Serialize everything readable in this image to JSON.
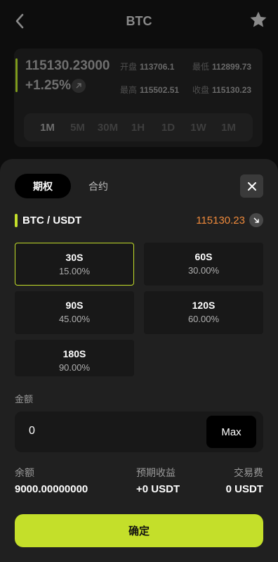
{
  "header": {
    "title": "BTC",
    "back_icon": "chevron-left-icon",
    "favorite_icon": "star-icon"
  },
  "ticker": {
    "price": "115130.23000",
    "change": "+1.25%",
    "open_label": "开盘",
    "open_value": "113706.1",
    "low_label": "最低",
    "low_value": "112899.73",
    "high_label": "最高",
    "high_value": "115502.51",
    "close_label": "收盘",
    "close_value": "115130.23",
    "timeframes": [
      "1M",
      "5M",
      "30M",
      "1H",
      "1D",
      "1W",
      "1M"
    ],
    "active_timeframe": "1M"
  },
  "sheet": {
    "tabs": [
      "期权",
      "合约"
    ],
    "active_tab": "期权",
    "close_icon": "close-icon",
    "pair": "BTC / USDT",
    "pair_price": "115130.23",
    "periods": [
      {
        "label": "30S",
        "rate": "15.00%",
        "selected": true
      },
      {
        "label": "60S",
        "rate": "30.00%",
        "selected": false
      },
      {
        "label": "90S",
        "rate": "45.00%",
        "selected": false
      },
      {
        "label": "120S",
        "rate": "60.00%",
        "selected": false
      },
      {
        "label": "180S",
        "rate": "90.00%",
        "selected": false
      }
    ],
    "amount_label": "金额",
    "amount_value": "0",
    "max_label": "Max",
    "balance_label": "余额",
    "balance_value": "9000.00000000",
    "expected_label": "预期收益",
    "expected_value": "+0 USDT",
    "fee_label": "交易费",
    "fee_value": "0 USDT",
    "confirm_label": "确定"
  },
  "colors": {
    "accent": "#c4df2a",
    "price_orange": "#ef8a3b",
    "sheet_bg": "#202020",
    "page_bg": "#0d0d0d"
  }
}
